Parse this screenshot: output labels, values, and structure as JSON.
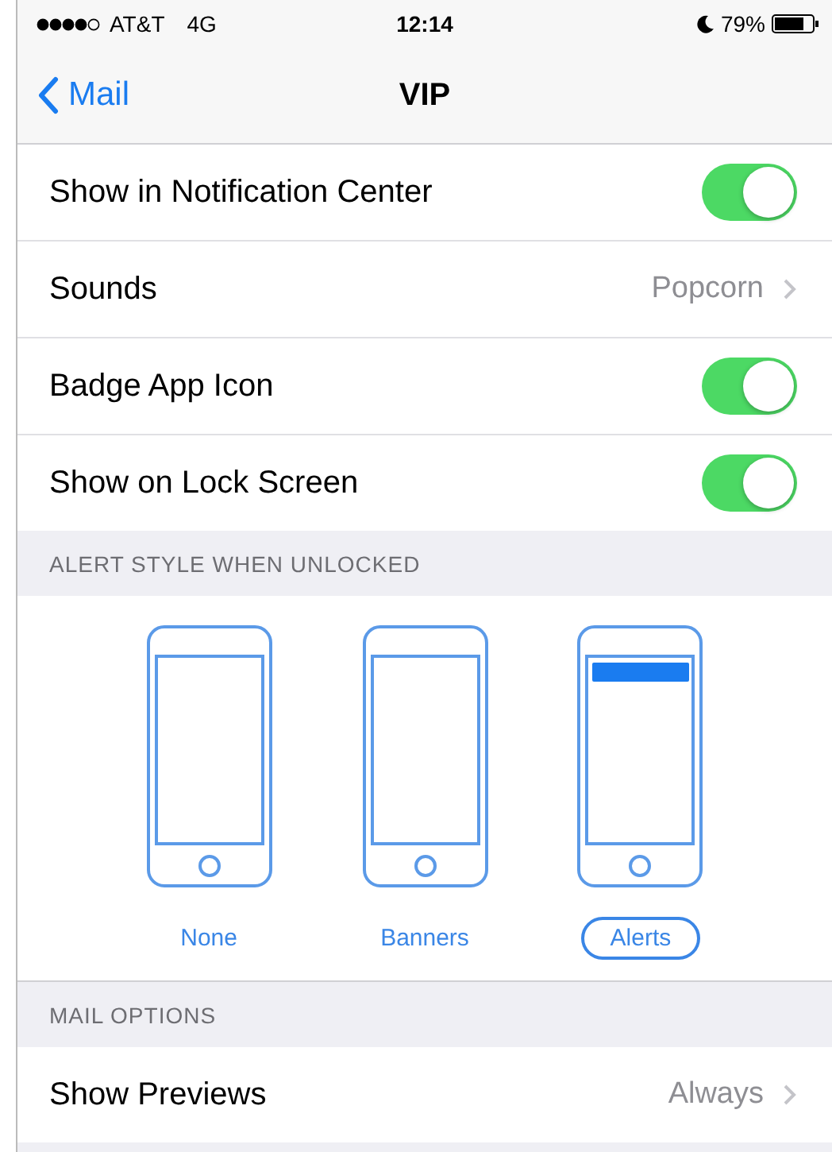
{
  "status_bar": {
    "carrier": "AT&T",
    "network": "4G",
    "time": "12:14",
    "battery": "79%"
  },
  "nav": {
    "back": "Mail",
    "title": "VIP"
  },
  "rows": [
    {
      "kind": "toggle",
      "label": "Show in Notification Center",
      "on": true
    },
    {
      "kind": "value",
      "label": "Sounds",
      "value": "Popcorn"
    },
    {
      "kind": "toggle",
      "label": "Badge App Icon",
      "on": true
    },
    {
      "kind": "toggle",
      "label": "Show on Lock Screen",
      "on": true
    }
  ],
  "alert_section": {
    "header": "ALERT STYLE WHEN UNLOCKED",
    "styles": [
      {
        "kind": "none",
        "label": "None",
        "selected": false
      },
      {
        "kind": "banners",
        "label": "Banners",
        "selected": false
      },
      {
        "kind": "alerts",
        "label": "Alerts",
        "selected": true
      }
    ]
  },
  "mail_section": {
    "header": "MAIL OPTIONS",
    "rows": [
      {
        "kind": "value",
        "label": "Show Previews",
        "value": "Always"
      }
    ]
  }
}
